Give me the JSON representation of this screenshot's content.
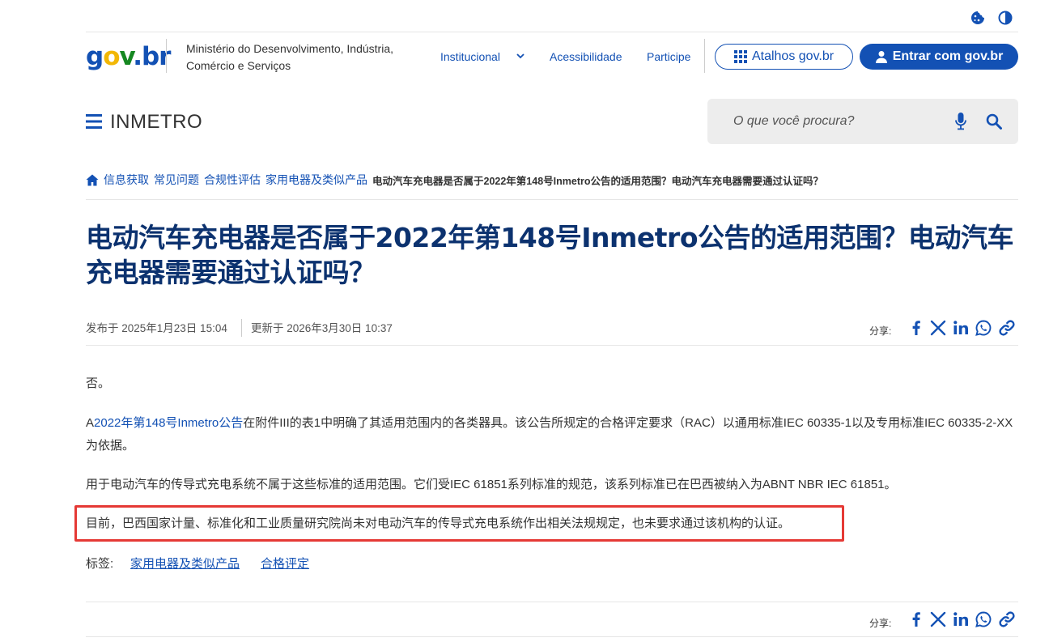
{
  "header": {
    "logo_parts": {
      "g": "g",
      "o": "o",
      "v": "v",
      "dot": ".",
      "br": "br"
    },
    "ministry_line1": "Ministério do Desenvolvimento, Indústria,",
    "ministry_line2": "Comércio e Serviços",
    "nav": {
      "institucional": "Institucional",
      "acessibilidade": "Acessibilidade",
      "participe": "Participe"
    },
    "atalhos_label": "Atalhos gov.br",
    "entrar_label": "Entrar com gov.br",
    "site_title": "INMETRO",
    "search_placeholder": "O que você procura?"
  },
  "breadcrumb": {
    "items": [
      "信息获取",
      "常见问题",
      "合规性评估",
      "家用电器及类似产品"
    ],
    "current": "电动汽车充电器是否属于2022年第148号Inmetro公告的适用范围？电动汽车充电器需要通过认证吗？"
  },
  "article": {
    "title": "电动汽车充电器是否属于2022年第148号Inmetro公告的适用范围？电动汽车充电器需要通过认证吗？",
    "published": "发布于 2025年1月23日 15:04",
    "updated": "更新于 2026年3月30日 10:37",
    "share_label": "分享:",
    "p1": "否。",
    "p2_prefix": "A",
    "p2_link": "2022年第148号Inmetro公告",
    "p2_rest": "在附件III的表1中明确了其适用范围内的各类器具。该公告所规定的合格评定要求（RAC）以通用标准IEC 60335-1以及专用标准IEC 60335-2-XX为依据。",
    "p3": "用于电动汽车的传导式充电系统不属于这些标准的适用范围。它们受IEC 61851系列标准的规范，该系列标准已在巴西被纳入为ABNT NBR IEC 61851。",
    "p4": "目前，巴西国家计量、标准化和工业质量研究院尚未对电动汽车的传导式充电系统作出相关法规规定，也未要求通过该机构的认证。",
    "tags_label": "标签:",
    "tags": [
      "家用电器及类似产品",
      "合格评定"
    ]
  },
  "colors": {
    "primary": "#1351b4",
    "title": "#0c326f",
    "highlight_border": "#e53935"
  },
  "icons": [
    "cookie-icon",
    "contrast-icon",
    "chevron-down-icon",
    "grid-icon",
    "user-icon",
    "menu-icon",
    "microphone-icon",
    "search-icon",
    "home-icon",
    "facebook-icon",
    "x-icon",
    "linkedin-icon",
    "whatsapp-icon",
    "link-icon"
  ]
}
